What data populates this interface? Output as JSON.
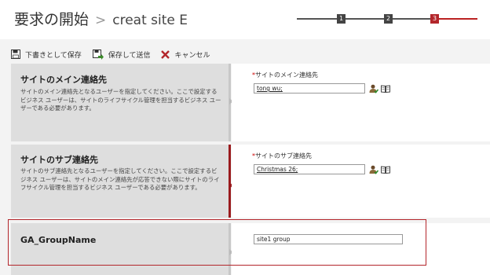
{
  "header": {
    "title": "要求の開始",
    "separator": ">",
    "site_name": "creat site E",
    "steps": [
      "1",
      "2",
      "3"
    ],
    "current_step": "3"
  },
  "toolbar": {
    "save_draft_label": "下書きとして保存",
    "save_send_label": "保存して送信",
    "cancel_label": "キャンセル"
  },
  "sections": [
    {
      "title": "サイトのメイン連絡先",
      "description": "サイトのメイン連絡先となるユーザーを指定してください。ここで設定するビジネス ユーザーは、サイトのライフサイクル管理を担当するビジネス ユーザーである必要があります。",
      "field_label": "サイトのメイン連絡先",
      "field_value": "tong wu;"
    },
    {
      "title": "サイトのサブ連絡先",
      "description": "サイトのサブ連絡先となるユーザーを指定してください。ここで設定するビジネス ユーザーは、サイトのメイン連絡先が応答できない際にサイトのライフサイクル管理を担当するビジネス ユーザーである必要があります。",
      "field_label": "サイトのサブ連絡先",
      "field_value": "Christmas 26;"
    },
    {
      "title": "GA_GroupName",
      "field_value": "site1 group"
    }
  ],
  "required_marker": "*",
  "colors": {
    "accent": "#b3262b",
    "left_panel": "#dedede",
    "background": "#f3f3f3"
  }
}
